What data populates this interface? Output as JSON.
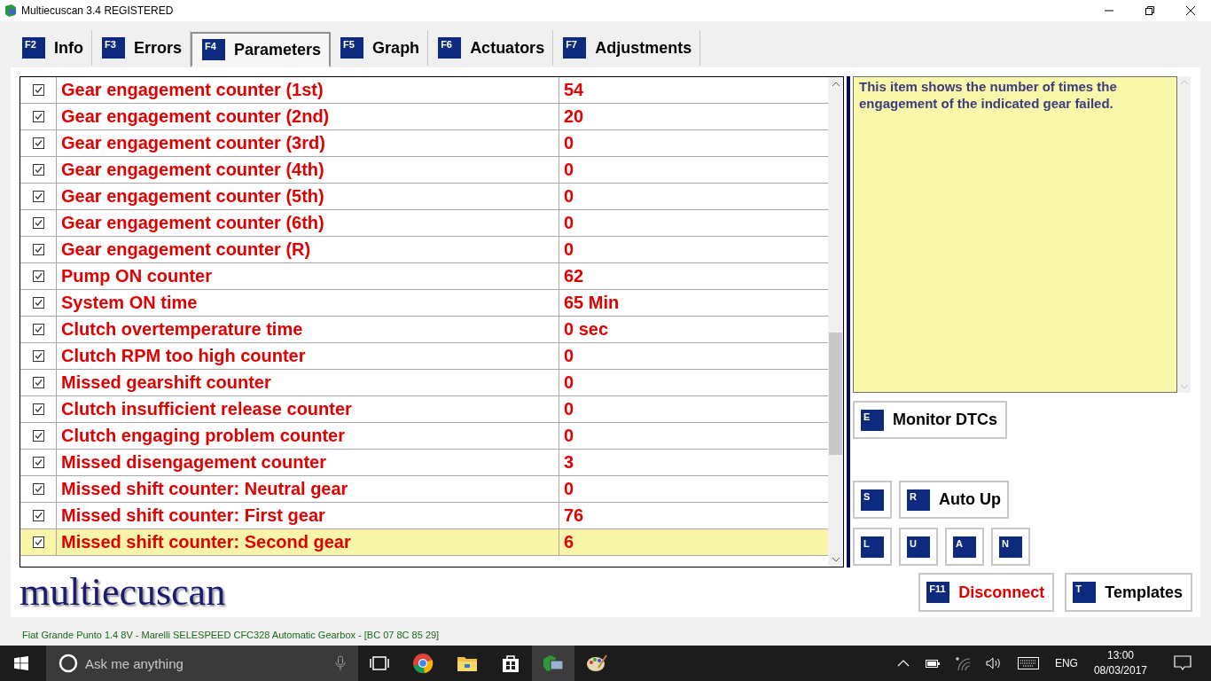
{
  "window": {
    "title": "Multiecuscan 3.4 REGISTERED"
  },
  "tabs": [
    {
      "key": "F2",
      "label": "Info",
      "selected": false
    },
    {
      "key": "F3",
      "label": "Errors",
      "selected": false
    },
    {
      "key": "F4",
      "label": "Parameters",
      "selected": true
    },
    {
      "key": "F5",
      "label": "Graph",
      "selected": false
    },
    {
      "key": "F6",
      "label": "Actuators",
      "selected": false
    },
    {
      "key": "F7",
      "label": "Adjustments",
      "selected": false
    }
  ],
  "parameters": {
    "rows": [
      {
        "checked": true,
        "name": "Gear engagement counter (1st)",
        "value": "54",
        "selected": false
      },
      {
        "checked": true,
        "name": "Gear engagement counter (2nd)",
        "value": "20",
        "selected": false
      },
      {
        "checked": true,
        "name": "Gear engagement counter (3rd)",
        "value": "0",
        "selected": false
      },
      {
        "checked": true,
        "name": "Gear engagement counter (4th)",
        "value": "0",
        "selected": false
      },
      {
        "checked": true,
        "name": "Gear engagement counter (5th)",
        "value": "0",
        "selected": false
      },
      {
        "checked": true,
        "name": "Gear engagement counter (6th)",
        "value": "0",
        "selected": false
      },
      {
        "checked": true,
        "name": "Gear engagement counter (R)",
        "value": "0",
        "selected": false
      },
      {
        "checked": true,
        "name": "Pump ON counter",
        "value": "62",
        "selected": false
      },
      {
        "checked": true,
        "name": "System ON time",
        "value": "65 Min",
        "selected": false
      },
      {
        "checked": true,
        "name": "Clutch overtemperature time",
        "value": "0 sec",
        "selected": false
      },
      {
        "checked": true,
        "name": "Clutch RPM too high counter",
        "value": "0",
        "selected": false
      },
      {
        "checked": true,
        "name": "Missed gearshift counter",
        "value": "0",
        "selected": false
      },
      {
        "checked": true,
        "name": "Clutch insufficient release counter",
        "value": "0",
        "selected": false
      },
      {
        "checked": true,
        "name": "Clutch engaging problem counter",
        "value": "0",
        "selected": false
      },
      {
        "checked": true,
        "name": "Missed disengagement counter",
        "value": "3",
        "selected": false
      },
      {
        "checked": true,
        "name": "Missed shift counter: Neutral gear",
        "value": "0",
        "selected": false
      },
      {
        "checked": true,
        "name": "Missed shift counter: First gear",
        "value": "76",
        "selected": false
      },
      {
        "checked": true,
        "name": "Missed shift counter: Second gear",
        "value": "6",
        "selected": true
      }
    ]
  },
  "description": "This item shows the number of times the engagement of the indicated gear failed.",
  "monitor_button": {
    "key": "E",
    "label": "Monitor DTCs"
  },
  "gear_controls": {
    "row_1": [
      {
        "key": "S"
      },
      {
        "key": "R",
        "label": "Auto Up"
      }
    ],
    "row_2": [
      {
        "key": "L"
      },
      {
        "key": "U"
      },
      {
        "key": "A"
      },
      {
        "key": "N"
      }
    ]
  },
  "bottom_buttons": [
    {
      "key": "F11",
      "label": "Disconnect",
      "kind": "danger"
    },
    {
      "key": "T",
      "label": "Templates",
      "kind": "normal"
    }
  ],
  "logo": "multiecuscan",
  "status_bar": "Fiat Grande Punto 1.4 8V - Marelli SELESPEED CFC328 Automatic Gearbox - [BC 07 8C 85 29]",
  "taskbar": {
    "search_placeholder": "Ask me anything",
    "language": "ENG",
    "time": "13:00",
    "date": "08/03/2017"
  }
}
